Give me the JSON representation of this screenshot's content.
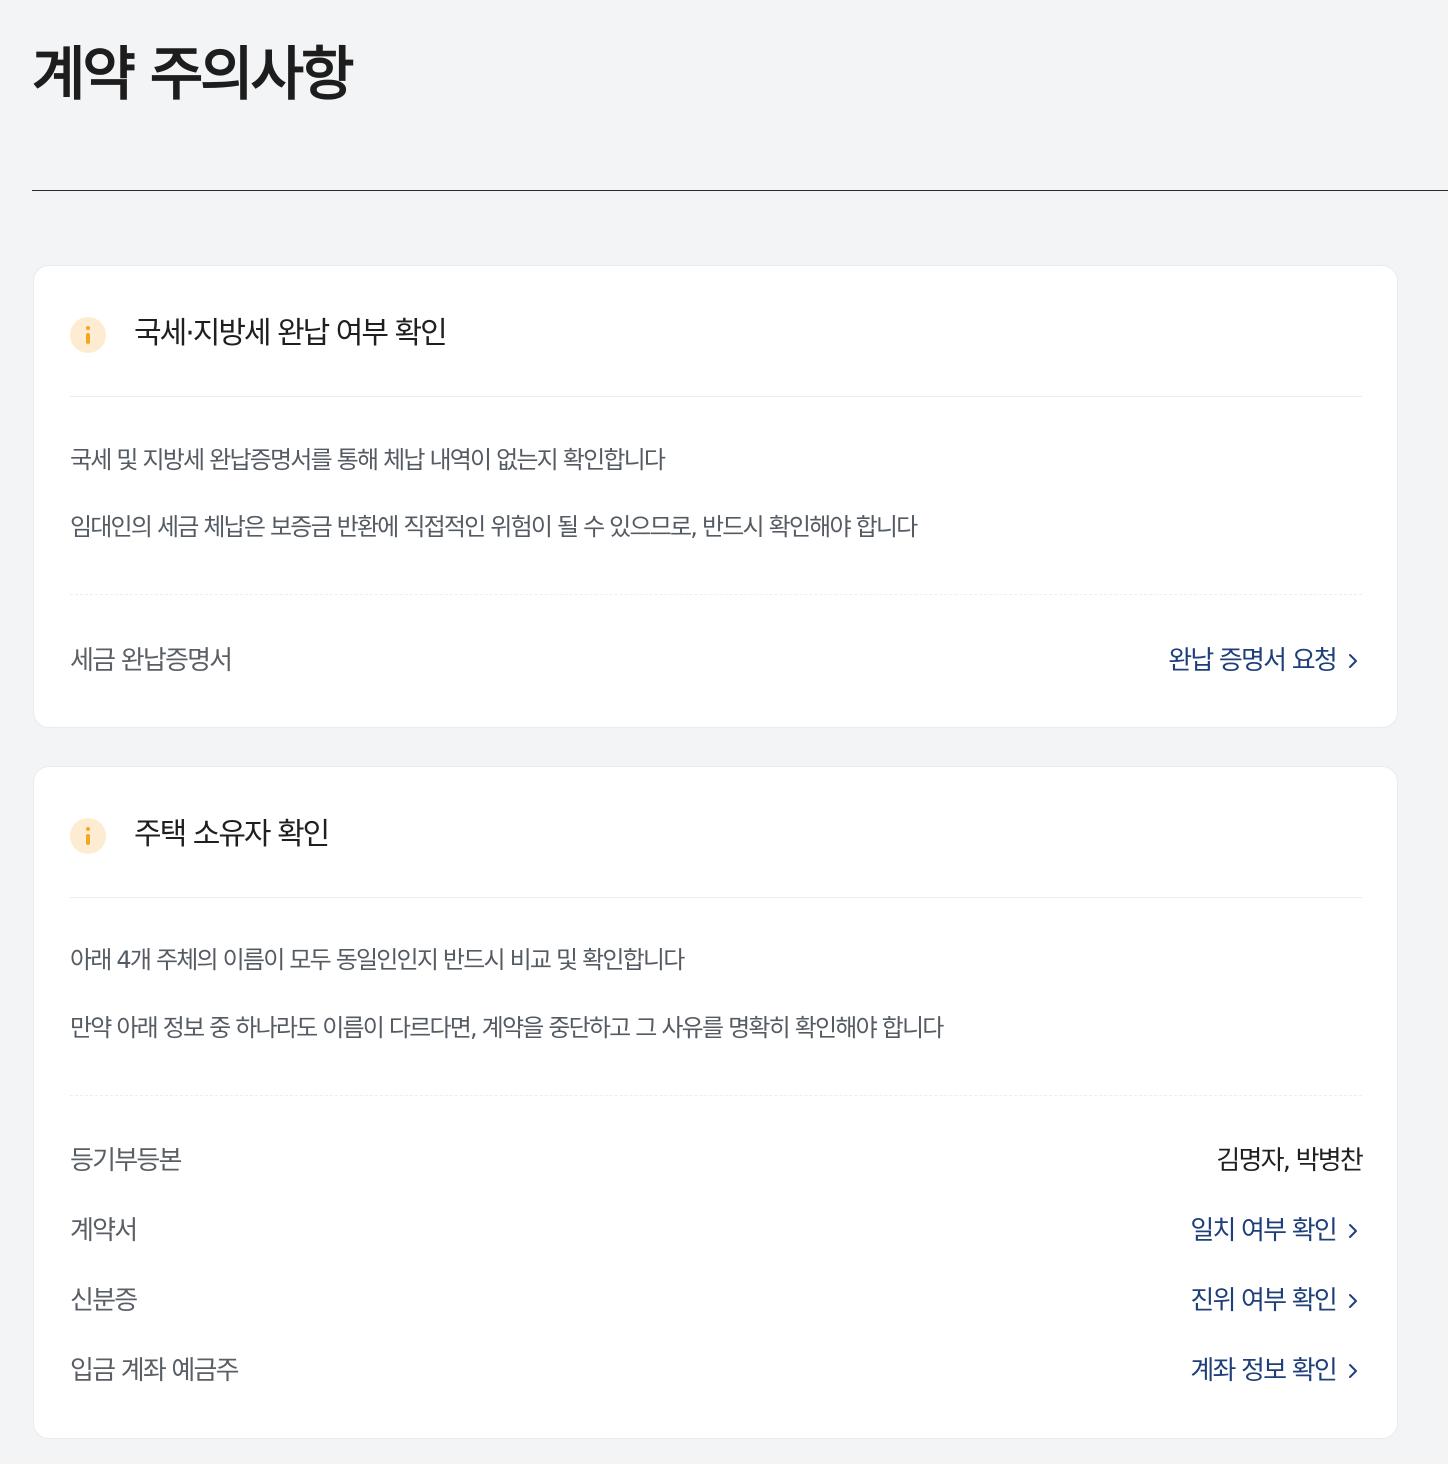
{
  "page": {
    "title": "계약 주의사항"
  },
  "colors": {
    "background": "#f3f4f6",
    "card": "#ffffff",
    "link": "#1f3f7a",
    "info_badge_bg": "#fdecd2",
    "info_badge_fg": "#f5a623"
  },
  "cards": [
    {
      "icon": "info-icon",
      "title": "국세·지방세 완납 여부 확인",
      "descriptions": [
        "국세 및 지방세 완납증명서를 통해 체납 내역이 없는지 확인합니다",
        "임대인의 세금 체납은 보증금 반환에 직접적인 위험이 될 수 있으므로, 반드시 확인해야 합니다"
      ],
      "rows": [
        {
          "label": "세금 완납증명서",
          "link": "완납 증명서 요청"
        }
      ]
    },
    {
      "icon": "info-icon",
      "title": "주택 소유자 확인",
      "descriptions": [
        "아래 4개 주체의 이름이 모두 동일인인지 반드시 비교 및 확인합니다",
        "만약 아래 정보 중 하나라도 이름이 다르다면, 계약을 중단하고 그 사유를 명확히 확인해야 합니다"
      ],
      "rows": [
        {
          "label": "등기부등본",
          "value": "김명자, 박병찬"
        },
        {
          "label": "계약서",
          "link": "일치 여부 확인"
        },
        {
          "label": "신분증",
          "link": "진위 여부 확인"
        },
        {
          "label": "입금 계좌 예금주",
          "link": "계좌 정보 확인"
        }
      ]
    }
  ]
}
